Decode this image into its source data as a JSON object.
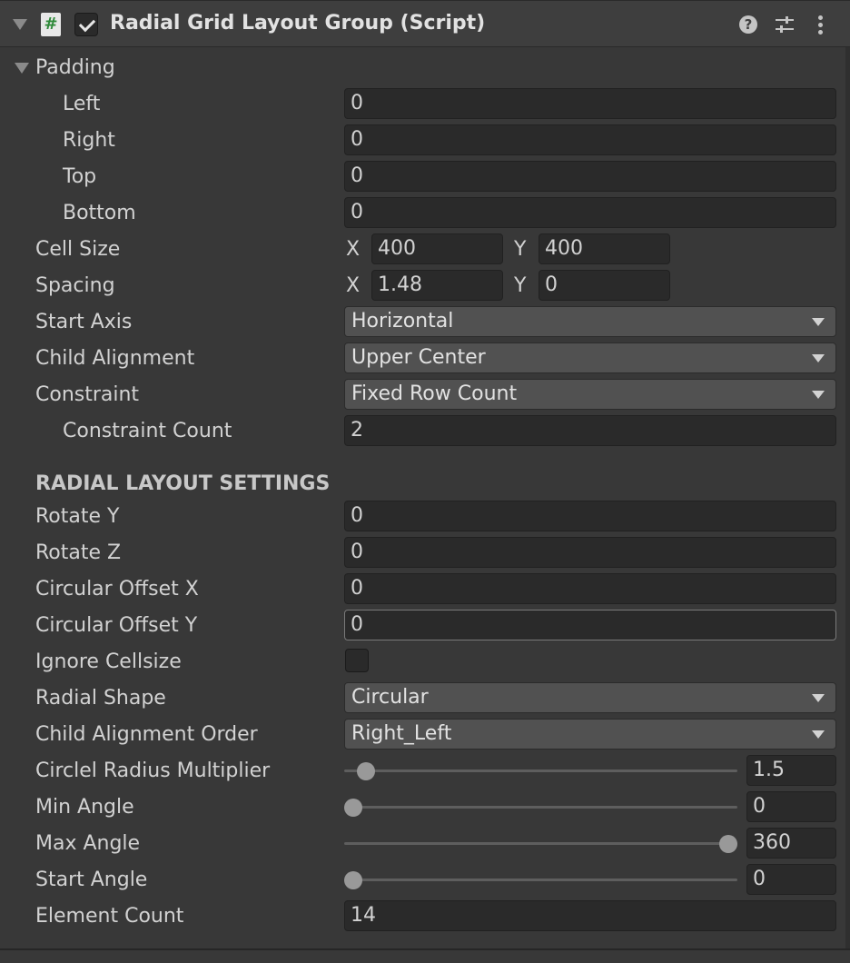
{
  "component": {
    "title": "Radial Grid Layout Group (Script)",
    "script_icon_glyph": "#",
    "enabled": true,
    "icons": [
      "fold-arrow-icon",
      "script-icon",
      "help-icon",
      "preset-icon",
      "more-icon"
    ]
  },
  "padding": {
    "label": "Padding",
    "left_label": "Left",
    "left": "0",
    "right_label": "Right",
    "right": "0",
    "top_label": "Top",
    "top": "0",
    "bottom_label": "Bottom",
    "bottom": "0"
  },
  "cell_size": {
    "label": "Cell Size",
    "x_label": "X",
    "x": "400",
    "y_label": "Y",
    "y": "400"
  },
  "spacing": {
    "label": "Spacing",
    "x_label": "X",
    "x": "1.48",
    "y_label": "Y",
    "y": "0"
  },
  "start_axis": {
    "label": "Start Axis",
    "value": "Horizontal"
  },
  "child_alignment": {
    "label": "Child Alignment",
    "value": "Upper Center"
  },
  "constraint": {
    "label": "Constraint",
    "value": "Fixed Row Count"
  },
  "constraint_count": {
    "label": "Constraint Count",
    "value": "2"
  },
  "radial": {
    "heading": "RADIAL LAYOUT SETTINGS",
    "rotate_y": {
      "label": "Rotate Y",
      "value": "0"
    },
    "rotate_z": {
      "label": "Rotate Z",
      "value": "0"
    },
    "circular_offset_x": {
      "label": "Circular Offset X",
      "value": "0"
    },
    "circular_offset_y": {
      "label": "Circular Offset Y",
      "value": "0"
    },
    "ignore_cellsize": {
      "label": "Ignore Cellsize",
      "checked": false
    },
    "radial_shape": {
      "label": "Radial Shape",
      "value": "Circular"
    },
    "child_alignment_order": {
      "label": "Child Alignment Order",
      "value": "Right_Left"
    },
    "circle_radius_multiplier": {
      "label": "Circlel Radius Multiplier",
      "value": "1.5",
      "slider_fraction": 0.035
    },
    "min_angle": {
      "label": "Min Angle",
      "value": "0",
      "slider_fraction": 0.0
    },
    "max_angle": {
      "label": "Max Angle",
      "value": "360",
      "slider_fraction": 1.0
    },
    "start_angle": {
      "label": "Start Angle",
      "value": "0",
      "slider_fraction": 0.0
    },
    "element_count": {
      "label": "Element Count",
      "value": "14"
    }
  },
  "colors": {
    "background": "#383838",
    "field": "#2a2a2a",
    "dropdown": "#515151",
    "text": "#d2d2d2",
    "script_icon_green": "#2f8a3a"
  }
}
